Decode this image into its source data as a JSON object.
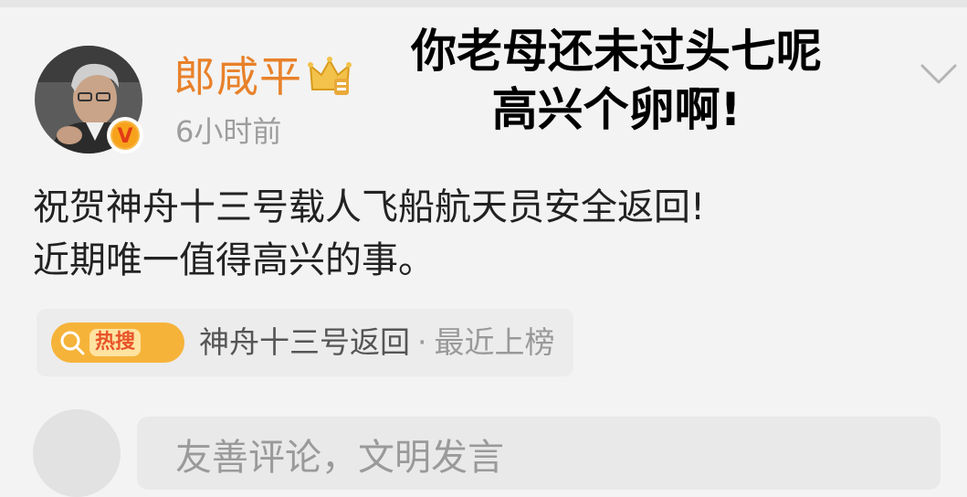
{
  "post": {
    "author": "郎咸平",
    "time": "6小时前",
    "verified_badge": "V",
    "text_lines": [
      "祝贺神舟十三号载人飞船航天员安全返回!",
      "近期唯一值得高兴的事。"
    ]
  },
  "overlay": {
    "lines": [
      "你老母还未过头七呢",
      "高兴个卵啊!"
    ]
  },
  "hot_search": {
    "badge": "热搜",
    "topic": "神舟十三号返回",
    "separator": "·",
    "status": "最近上榜"
  },
  "comment": {
    "placeholder": "友善评论，文明发言"
  },
  "icons": {
    "crown": "crown-icon",
    "chevron": "chevron-down-icon",
    "search": "search-icon"
  },
  "colors": {
    "username": "#e8812a",
    "badge": "#f6b33a",
    "background": "#f3f3f3"
  }
}
